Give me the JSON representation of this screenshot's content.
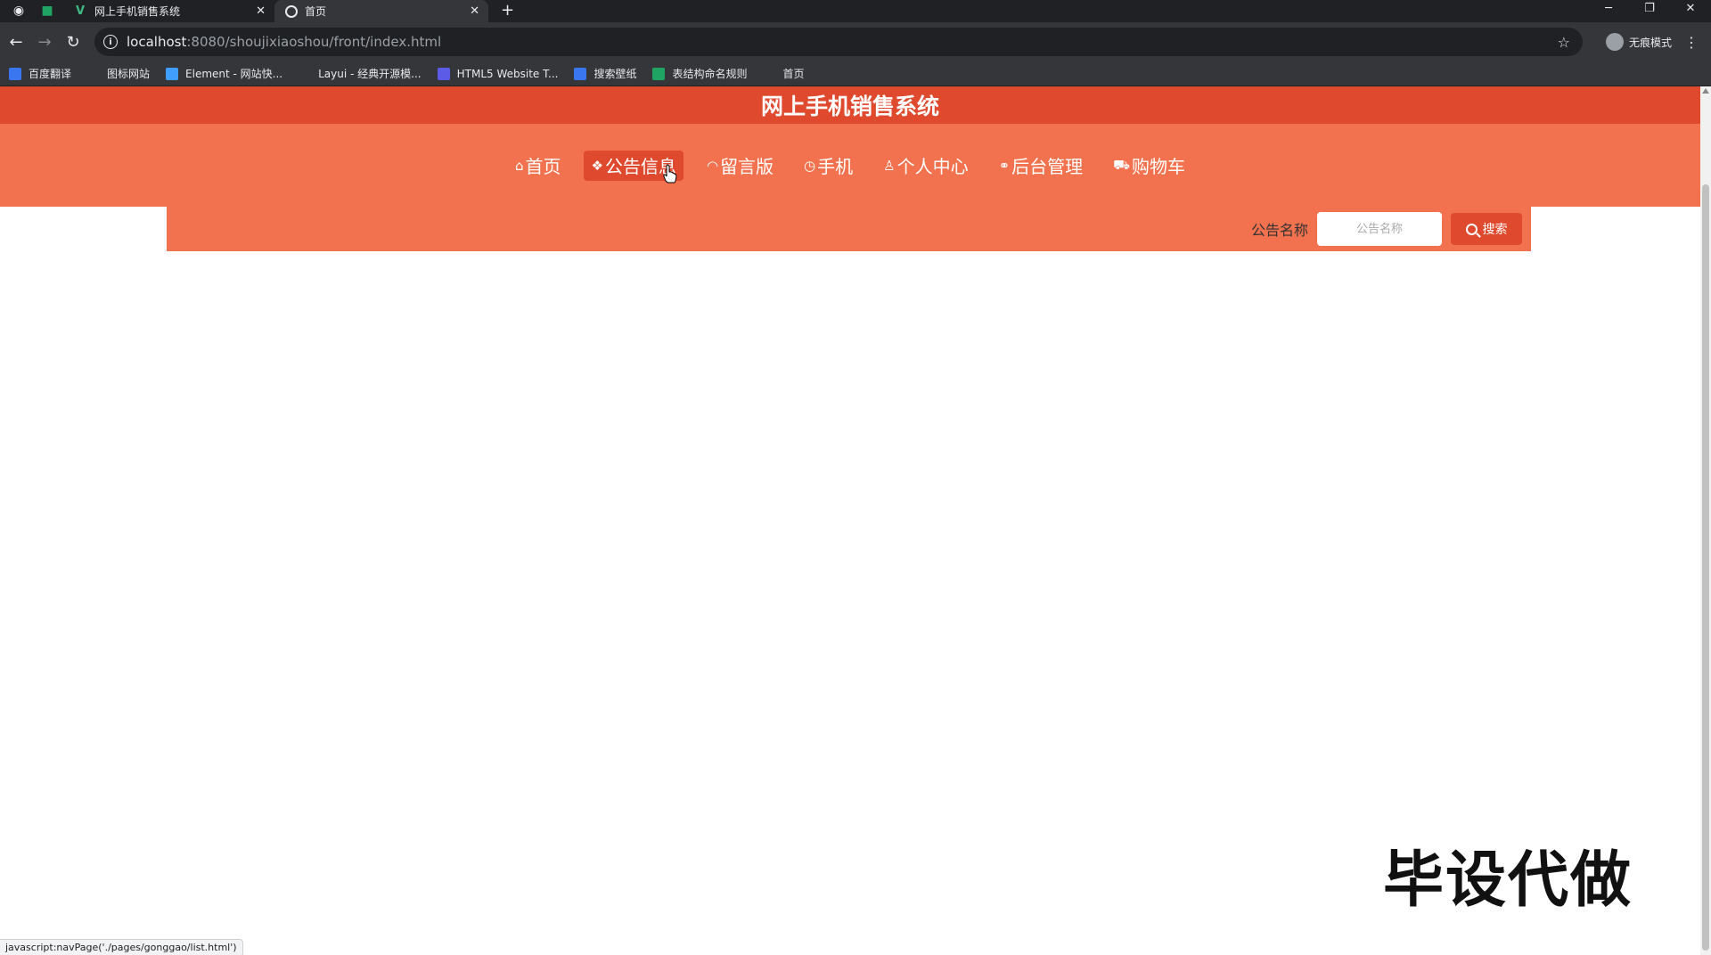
{
  "browser": {
    "tabs": [
      {
        "title": "网上手机销售系统",
        "icon": "vue-logo-icon"
      },
      {
        "title": "首页",
        "icon": "globe-icon"
      }
    ],
    "url_host": "localhost",
    "url_rest": ":8080/shoujixiaoshou/front/index.html",
    "profile_label": "无痕模式",
    "bookmarks": [
      {
        "label": "百度翻译",
        "color": "#3a76f0",
        "icon": "translate-icon"
      },
      {
        "label": "图标网站",
        "color": "#35363a",
        "icon": "flag-icon"
      },
      {
        "label": "Element - 网站快...",
        "color": "#409eff",
        "icon": "element-icon"
      },
      {
        "label": "Layui - 经典开源模...",
        "color": "#35363a",
        "icon": "layui-icon"
      },
      {
        "label": "HTML5 Website T...",
        "color": "#5b5be8",
        "icon": "html5-icon"
      },
      {
        "label": "搜索壁纸",
        "color": "#3a76f0",
        "icon": "wallpaper-icon"
      },
      {
        "label": "表结构命名规则",
        "color": "#1fa463",
        "icon": "sheet-icon"
      },
      {
        "label": "首页",
        "color": "#35363a",
        "icon": "globe-icon"
      }
    ],
    "status_text": "javascript:navPage('./pages/gonggao/list.html')"
  },
  "site": {
    "title": "网上手机销售系统",
    "nav": [
      {
        "label": "首页",
        "icon": "⌂",
        "active": false
      },
      {
        "label": "公告信息",
        "icon": "❖",
        "active": true
      },
      {
        "label": "留言版",
        "icon": "◠",
        "active": false
      },
      {
        "label": "手机",
        "icon": "◷",
        "active": false
      },
      {
        "label": "个人中心",
        "icon": "♙",
        "active": false
      },
      {
        "label": "后台管理",
        "icon": "⚭",
        "active": false
      },
      {
        "label": "购物车",
        "icon": "⛟",
        "active": false
      }
    ],
    "search": {
      "label": "公告名称",
      "placeholder": "公告名称",
      "button_label": "搜索"
    }
  },
  "watermark": "毕设代做",
  "colors": {
    "title_bar": "#df4a2f",
    "nav_bar": "#f2714e",
    "active_nav": "#df4a2f"
  }
}
